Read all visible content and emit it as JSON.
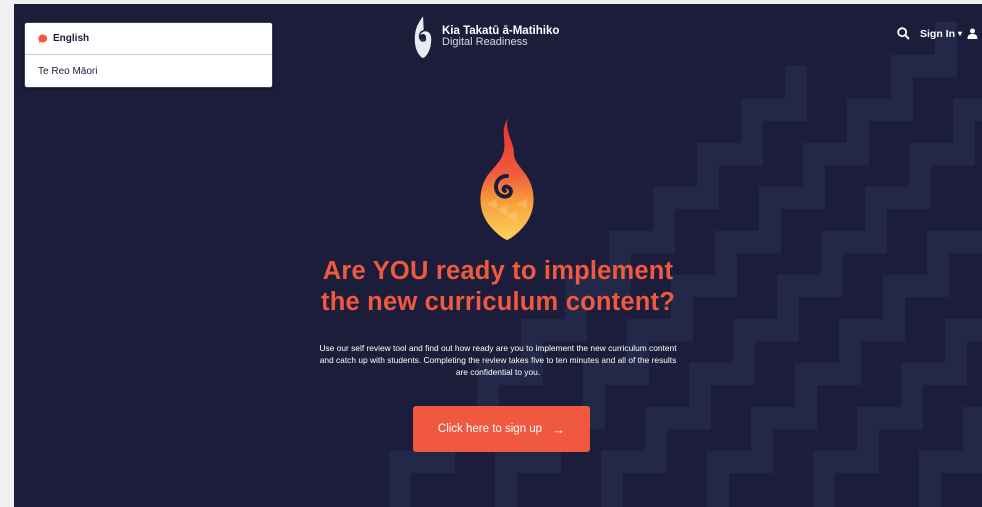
{
  "language_menu": {
    "items": [
      {
        "label": "English",
        "active": true
      },
      {
        "label": "Te Reo Māori",
        "active": false
      }
    ]
  },
  "brand": {
    "title": "Kia Takatū ā-Matihiko",
    "subtitle": "Digital Readiness"
  },
  "header": {
    "search_icon": "search-icon",
    "signin_label": "Sign In",
    "user_icon": "user-icon"
  },
  "hero": {
    "headline_line1": "Are YOU ready to implement",
    "headline_line2": "the new curriculum content?",
    "description_line1": "Use our self review tool and find out how ready are you to implement the new curriculum content",
    "description_line2": "and catch up with students. Completing the review takes five to ten minutes and all of the results",
    "description_line3": "are confidential to you.",
    "cta_label": "Click here to sign up",
    "cta_arrow": "→"
  },
  "colors": {
    "background": "#1b1d3b",
    "accent": "#f0593f",
    "pattern": "#24274a"
  }
}
